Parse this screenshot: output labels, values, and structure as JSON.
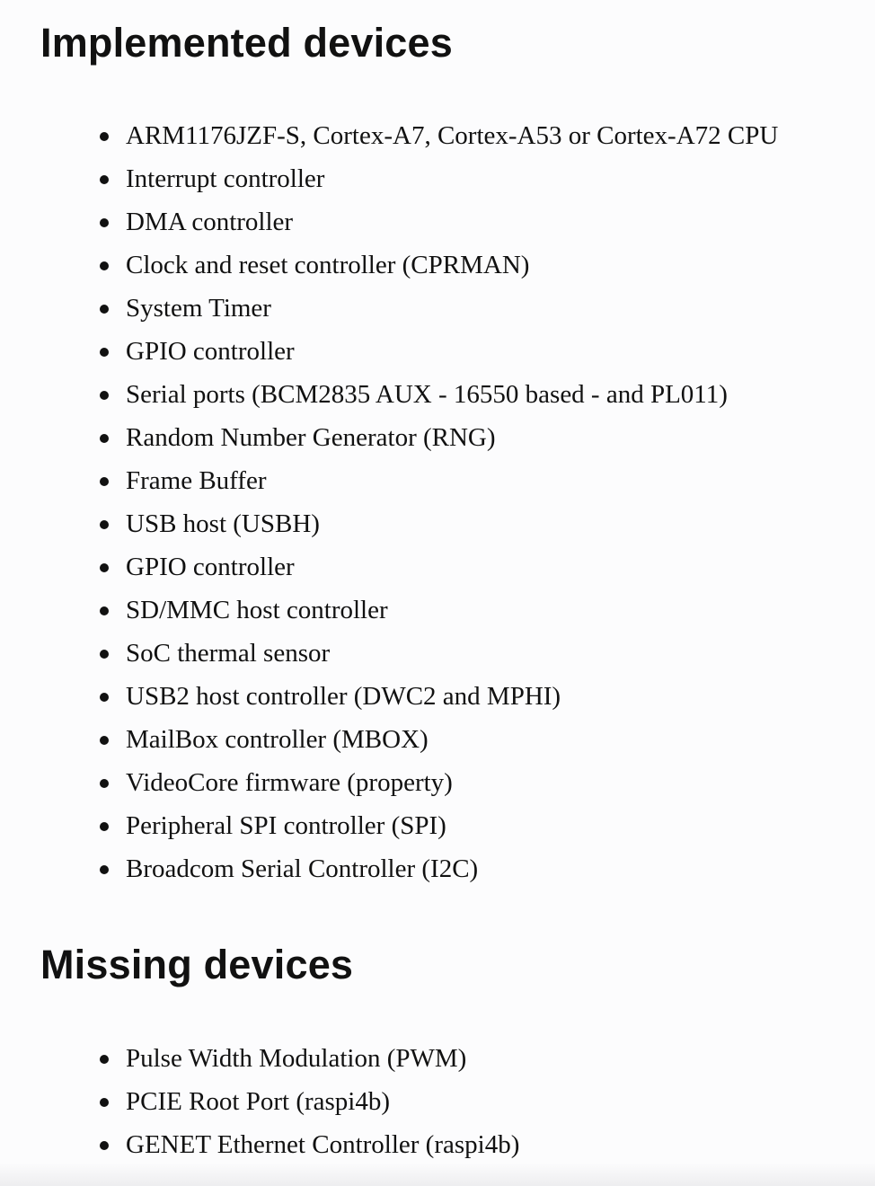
{
  "sections": {
    "implemented": {
      "heading": "Implemented devices",
      "items": [
        "ARM1176JZF-S, Cortex-A7, Cortex-A53 or Cortex-A72 CPU",
        "Interrupt controller",
        "DMA controller",
        "Clock and reset controller (CPRMAN)",
        "System Timer",
        "GPIO controller",
        "Serial ports (BCM2835 AUX - 16550 based - and PL011)",
        "Random Number Generator (RNG)",
        "Frame Buffer",
        "USB host (USBH)",
        "GPIO controller",
        "SD/MMC host controller",
        "SoC thermal sensor",
        "USB2 host controller (DWC2 and MPHI)",
        "MailBox controller (MBOX)",
        "VideoCore firmware (property)",
        "Peripheral SPI controller (SPI)",
        "Broadcom Serial Controller (I2C)"
      ]
    },
    "missing": {
      "heading": "Missing devices",
      "items": [
        "Pulse Width Modulation (PWM)",
        "PCIE Root Port (raspi4b)",
        "GENET Ethernet Controller (raspi4b)"
      ]
    }
  }
}
